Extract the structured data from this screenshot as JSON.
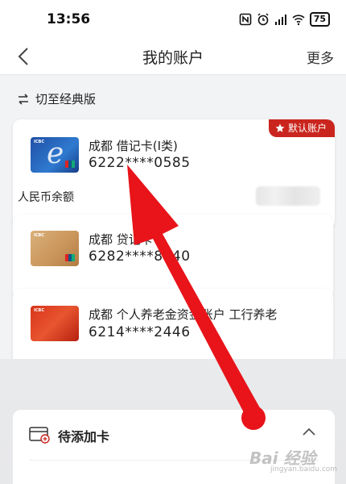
{
  "status_bar": {
    "time": "13:56",
    "battery": "75"
  },
  "nav": {
    "title": "我的账户",
    "more": "更多"
  },
  "switch": {
    "label": "切至经典版"
  },
  "accounts": [
    {
      "name": "成都 借记卡(I类)",
      "number": "6222****0585",
      "badge": "默认账户",
      "balance_label": "人民币余额"
    },
    {
      "name": "成都 贷记卡",
      "number": "6282****8740"
    },
    {
      "name": "成都 个人养老金资金账户 工行养老",
      "number": "6214****2446"
    }
  ],
  "pending": {
    "title": "待添加卡"
  },
  "watermark": {
    "brand": "Bai 经验",
    "url": "jingyan.baidu.com"
  },
  "colors": {
    "accent": "#c9251e",
    "arrow": "#e8141a"
  }
}
